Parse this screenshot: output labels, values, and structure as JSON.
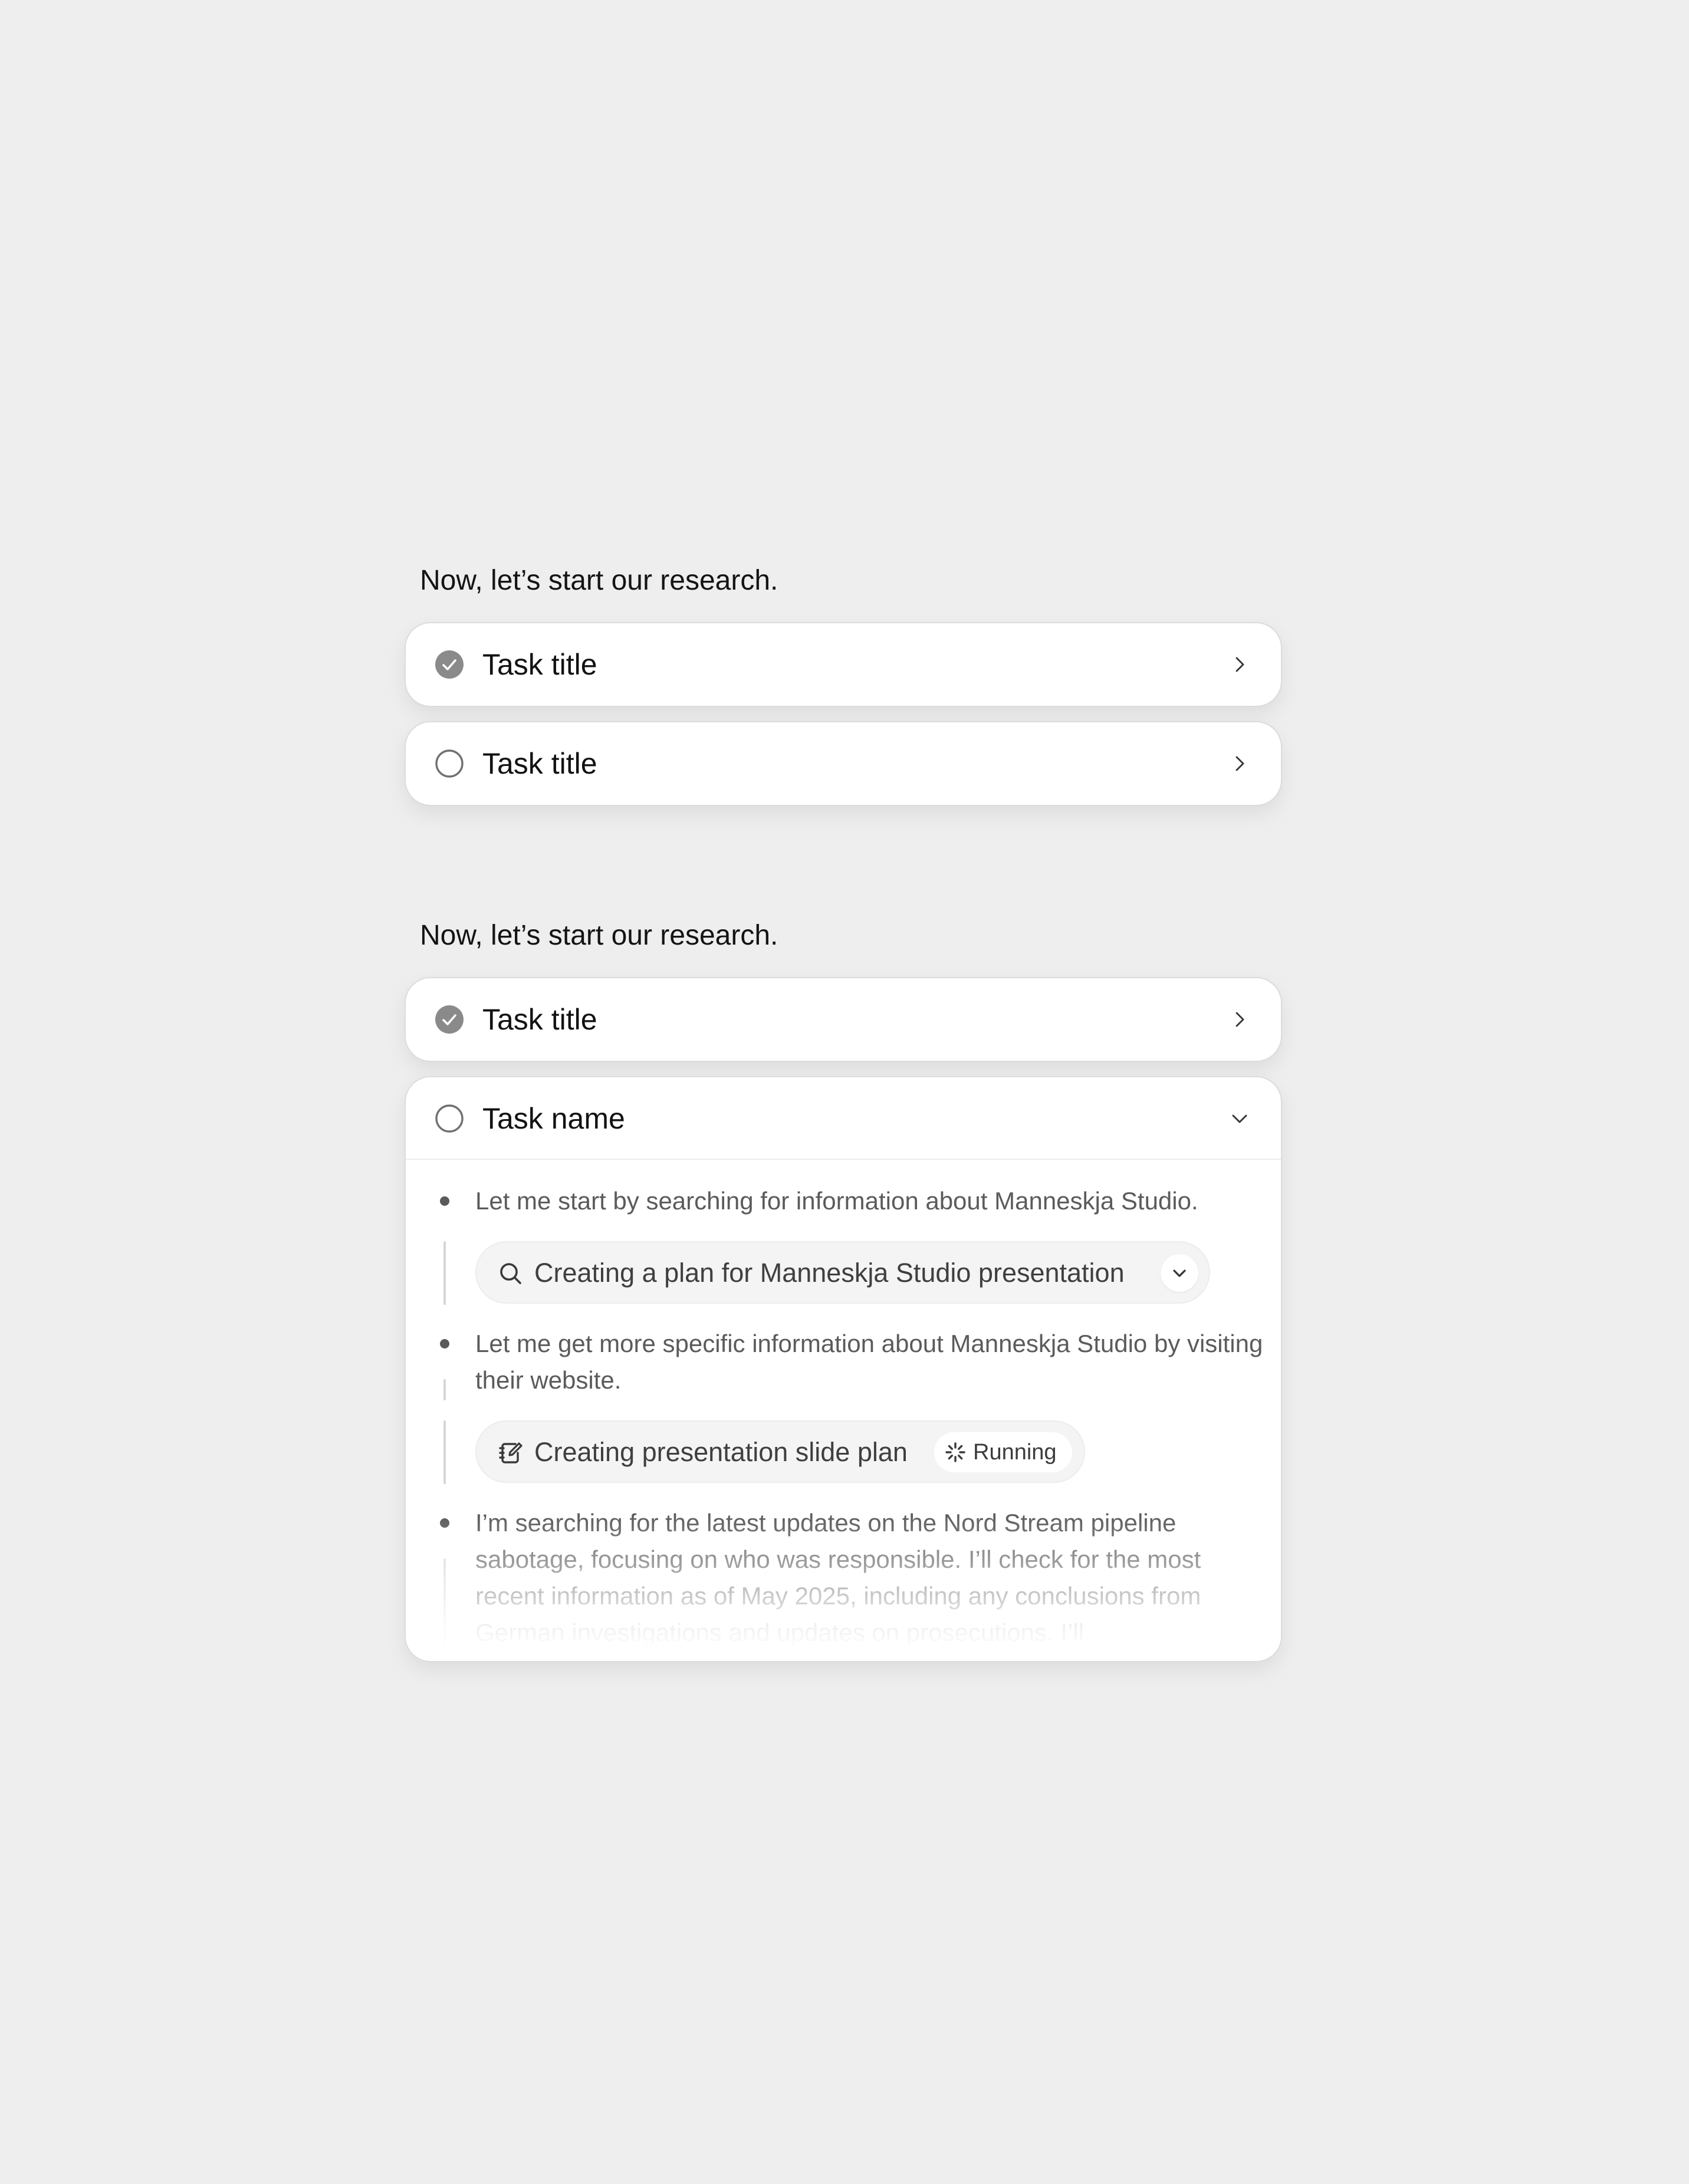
{
  "section_one": {
    "intro": "Now, let’s start our research.",
    "tasks": [
      {
        "title": "Task title",
        "status": "completed"
      },
      {
        "title": "Task title",
        "status": "pending"
      }
    ]
  },
  "section_two": {
    "intro": "Now, let’s start our research.",
    "tasks": [
      {
        "title": "Task title",
        "status": "completed"
      }
    ],
    "expanded_task": {
      "title": "Task name",
      "status": "pending",
      "steps": [
        {
          "text": "Let me start by searching for information about Manneskja Studio.",
          "tool": {
            "icon": "search-icon",
            "label": "Creating a plan for Manneskja Studio presentation"
          }
        },
        {
          "text": "Let me get more specific information about Manneskja Studio by visiting their website.",
          "tool": {
            "icon": "edit-note-icon",
            "label": "Creating presentation slide plan",
            "badge": "Running"
          }
        },
        {
          "text": "I’m searching for the latest updates on the Nord Stream pipeline sabotage, focusing on who was responsible. I’ll check for the most recent information as of May 2025, including any conclusions from German investigations and updates on prosecutions. I’ll"
        }
      ]
    }
  },
  "colors": {
    "background": "#eeeeee",
    "card": "#ffffff",
    "check_fill": "#8a8a8a",
    "muted_text": "#5b5b5b"
  }
}
